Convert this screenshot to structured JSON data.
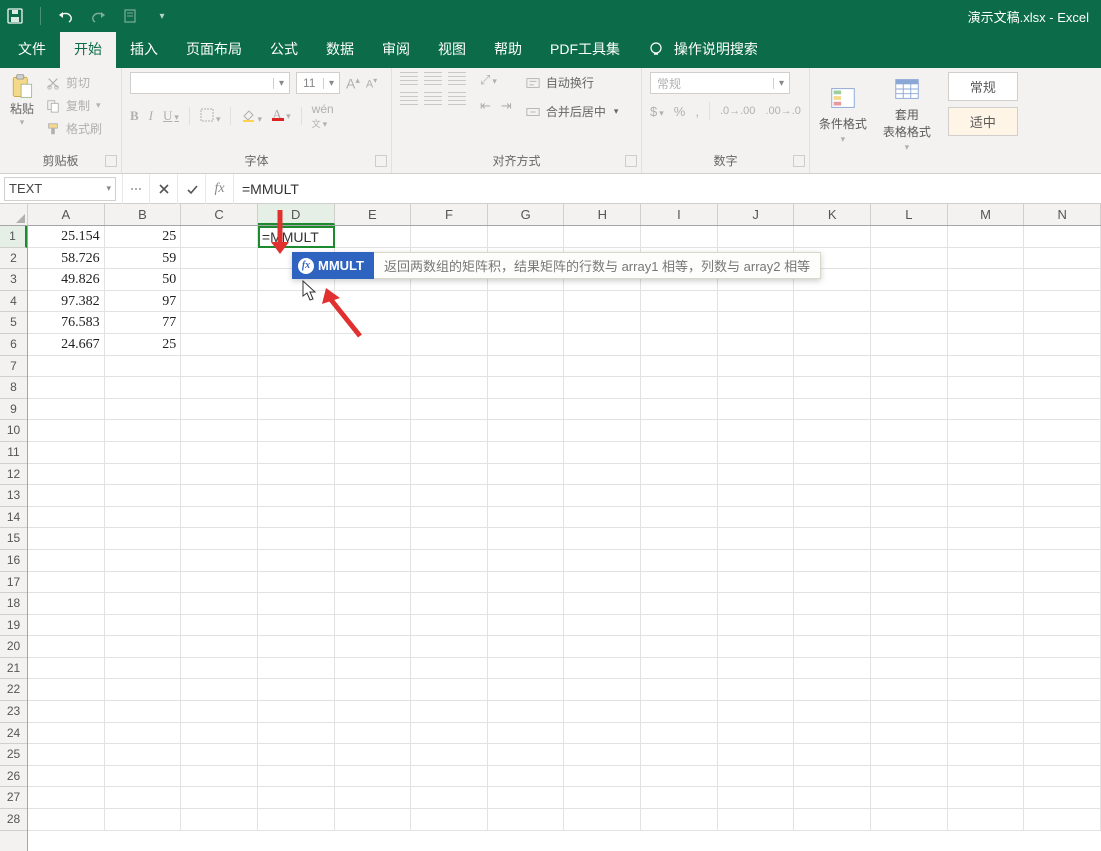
{
  "title": "演示文稿.xlsx  -  Excel",
  "qat": {
    "save": "save",
    "undo": "undo",
    "redo": "redo",
    "new": "new"
  },
  "tabs": [
    "文件",
    "开始",
    "插入",
    "页面布局",
    "公式",
    "数据",
    "审阅",
    "视图",
    "帮助",
    "PDF工具集",
    "操作说明搜索"
  ],
  "activeTab": 1,
  "clipboard": {
    "paste": "粘贴",
    "cut": "剪切",
    "copy": "复制",
    "painter": "格式刷",
    "group": "剪贴板"
  },
  "font": {
    "size": "11",
    "group": "字体",
    "bold": "B",
    "italic": "I",
    "underline": "U"
  },
  "align": {
    "group": "对齐方式",
    "wrap": "自动换行",
    "merge": "合并后居中"
  },
  "number": {
    "group": "数字",
    "general": "常规"
  },
  "styles": {
    "cond": "条件格式",
    "table": "套用\n表格格式",
    "normal": "常规",
    "good": "适中"
  },
  "namebox": "TEXT",
  "formula": "=MMULT",
  "cell_edit": "=MMULT",
  "tooltip": {
    "name": "MMULT",
    "desc": "返回两数组的矩阵积，结果矩阵的行数与 array1 相等，列数与 array2 相等"
  },
  "columns": [
    "A",
    "B",
    "C",
    "D",
    "E",
    "F",
    "G",
    "H",
    "I",
    "J",
    "K",
    "L",
    "M",
    "N"
  ],
  "rows": 28,
  "data": {
    "A": [
      "25.154",
      "58.726",
      "49.826",
      "97.382",
      "76.583",
      "24.667"
    ],
    "B": [
      "25",
      "59",
      "50",
      "97",
      "77",
      "25"
    ]
  }
}
